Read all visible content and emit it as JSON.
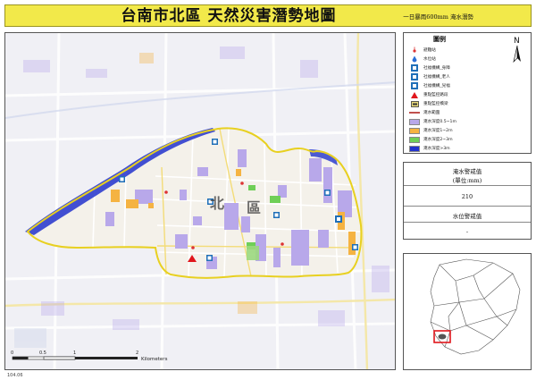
{
  "title": {
    "main": "台南市北區  天然災害潛勢地圖",
    "subtitle": "一日暴雨600mm 淹水潛勢"
  },
  "map": {
    "district_label_1": "北",
    "district_label_2": "區",
    "scalebar": {
      "ticks": [
        "0",
        "0.5",
        "1",
        "2"
      ],
      "unit": "Kilometers"
    }
  },
  "legend": {
    "title": "圖例",
    "north_label": "N",
    "items": [
      {
        "label": "避難站",
        "symbol": "shelter-icon",
        "color": "#d33"
      },
      {
        "label": "水位站",
        "symbol": "water-station-icon",
        "color": "#2a6fd6"
      },
      {
        "label": "社福機構_身障",
        "symbol": "disabled-icon",
        "color": "#1f6fb8"
      },
      {
        "label": "社福機構_老人",
        "symbol": "elderly-icon",
        "color": "#1f6fb8"
      },
      {
        "label": "社福機構_兒福",
        "symbol": "child-icon",
        "color": "#1f6fb8"
      },
      {
        "label": "重點監控路段",
        "symbol": "warning-icon",
        "color": "#e0161c"
      },
      {
        "label": "重點監控橋梁",
        "symbol": "bridge-icon",
        "color": "#333"
      },
      {
        "label": "淹水範圍",
        "symbol": "boundary-line",
        "color": "#c0504d"
      },
      {
        "label": "淹水深度0.5~1m",
        "symbol": "swatch",
        "color": "#b8a8ea"
      },
      {
        "label": "淹水深度1~2m",
        "symbol": "swatch",
        "color": "#f5b342"
      },
      {
        "label": "淹水深度2~3m",
        "symbol": "swatch",
        "color": "#6fcf57"
      },
      {
        "label": "淹水深度>3m",
        "symbol": "swatch",
        "color": "#2233cc"
      }
    ]
  },
  "warning": {
    "rain_title": "淹水警戒值",
    "rain_unit": "(單位:mm)",
    "rain_value": "210",
    "water_title": "水位警戒值",
    "water_value": "-"
  },
  "footer": {
    "date": "104.06"
  },
  "colors": {
    "title_bg": "#f2e94a",
    "boundary": "#e8d020",
    "flood_low": "#b8a8ea",
    "flood_mid": "#f5b342",
    "flood_deep": "#2233cc",
    "locator_highlight": "#e0161c"
  }
}
